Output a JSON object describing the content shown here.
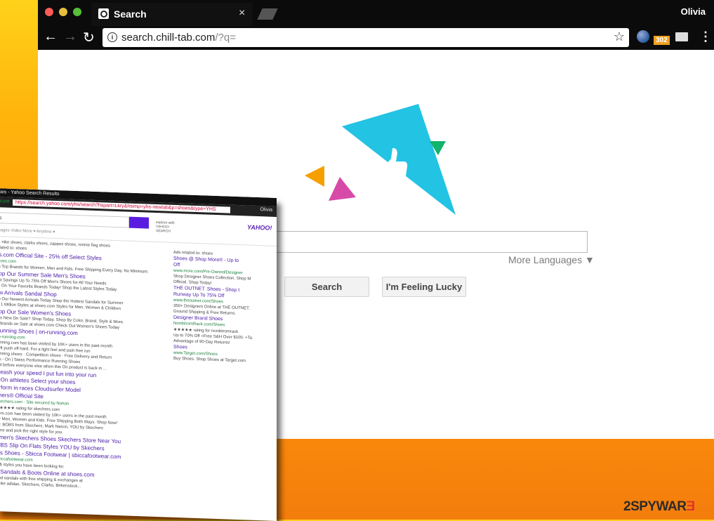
{
  "browser": {
    "tab_title": "Search",
    "tab_close": "×",
    "user": "Olivia",
    "url_host": "search.chill-tab.com",
    "url_rest": "/?q=",
    "ext_badge": "302",
    "back": "←",
    "forward": "→",
    "reload": "↻",
    "star": "☆",
    "menu": "⋮"
  },
  "page": {
    "more_languages": "More Languages ▼",
    "search_button": "Search",
    "lucky_button": "I'm Feeling Lucky",
    "logo_colors": {
      "main": "#22c3e3",
      "green": "#12b36d",
      "orange": "#f5a000",
      "pink": "#d84aa8"
    }
  },
  "overlay": {
    "title": "oes - Yahoo Search Results",
    "user": "Olivia",
    "secure": "ecure",
    "url": "https://search.yahoo.com/yhs/search?hspart=Lkry&hsimp=yhs-newtab&p=shoes&type=YHS",
    "query": "s",
    "yahoo_small": "explore with YAHOO! SEARCH",
    "yahoo_logo": "YAHOO!",
    "tabs": "Images      Video      More ▾      Anytime ▾",
    "results": [
      {
        "cls": "",
        "text": "ry: nike shoes, clarks shoes, zappos shoes, ronnie fieg shoes"
      },
      {
        "cls": "",
        "text": "related to: shoes"
      },
      {
        "cls": "h",
        "text": "es.com Official Site - 25% off Select Styles"
      },
      {
        "cls": "g",
        "text": "shoes.com"
      },
      {
        "cls": "",
        "text": "on Top Brands for Women, Men and Kids. Free Shipping Every Day, No Minimum."
      },
      {
        "cls": "h",
        "text": "hop Our Summer Sale        Men's Shoes"
      },
      {
        "cls": "",
        "text": "eat Savings Up To 75% Off    Men's Shoes for All Your Needs"
      },
      {
        "cls": "",
        "text": "ve On Your Favorite Brands Today!   Shop the Latest Styles Today"
      },
      {
        "cls": "h",
        "text": "ew Arrivals                Sandal Shop"
      },
      {
        "cls": "",
        "text": "op Our Newest Arrivals Today   Shop the Hottest Sandals for Summer"
      },
      {
        "cls": "",
        "text": "er 1 Million Styles at shoes.com   Styles for Men, Women & Children"
      },
      {
        "cls": "h",
        "text": "hop Our Sale               Women's Shoes"
      },
      {
        "cls": "",
        "text": "at's New On Sale? Shop Today.  Shop By Color, Brand, Style & More."
      },
      {
        "cls": "",
        "text": "p Brands on Sale at shoes.com   Check Out Women's Shoes Today"
      },
      {
        "cls": "h",
        "text": " Running Shoes | on-running.com"
      },
      {
        "cls": "g",
        "text": "on-running.com"
      },
      {
        "cls": "",
        "text": "running.com has been visited by 10K+ users in the past month"
      },
      {
        "cls": "",
        "text": "soft push off hard. For a light feel and pain free run"
      },
      {
        "cls": "",
        "text": "running shoes · Competition shoes · Free Delivery and Return"
      },
      {
        "cls": "",
        "text": "cts - On | Swiss Performance Running Shoes"
      },
      {
        "cls": "",
        "text": "out before everyone else when this On product is back in ..."
      },
      {
        "cls": "h",
        "text": "nleash your speed          I put fun into your run"
      },
      {
        "cls": "h",
        "text": "e On athletes              Select your shoes"
      },
      {
        "cls": "h",
        "text": "erform in races            Cloudsurfer Model"
      },
      {
        "cls": "h",
        "text": "chers® Official Site"
      },
      {
        "cls": "g",
        "text": "Skechers.com · Site secured by Norton"
      },
      {
        "cls": "",
        "text": "★★★★★ rating for skechers.com"
      },
      {
        "cls": "",
        "text": "hers.com has been visited by 10K+ users in the past month"
      },
      {
        "cls": "",
        "text": "for Men, Women and Kids. Free Shipping Both Ways. Shop Now!"
      },
      {
        "cls": "",
        "text": "ks: BOBS from Skechers, Mark Nason, YOU by Skechers"
      },
      {
        "cls": "",
        "text": "nline and pick the right style for you."
      },
      {
        "cls": "h",
        "text": "omen's Skechers Shoes       Skechers Store Near You"
      },
      {
        "cls": "h",
        "text": "OBS Slip On Flats Styles     YOU by Skechers"
      },
      {
        "cls": "h",
        "text": "n's Shoes - Sbicca Footwear | sbiccafootwear.com"
      },
      {
        "cls": "g",
        "text": "sbiccafootwear.com"
      },
      {
        "cls": "",
        "text": "n & styles you have been looking for."
      },
      {
        "cls": "h",
        "text": "s Sandals & Boots Online at shoes.com"
      },
      {
        "cls": "",
        "text": "and sandals with free shipping & exchanges at"
      },
      {
        "cls": "",
        "text": "...like adidas, Skechers, Clarks, Birkenstock..."
      }
    ],
    "ads": [
      {
        "cls": "",
        "text": "Ads related to: shoes"
      },
      {
        "cls": "h",
        "text": "Shoes @ Shop More® - Up to"
      },
      {
        "cls": "h",
        "text": "Off"
      },
      {
        "cls": "g",
        "text": "www.more.com/Pre-Owned/Designer"
      },
      {
        "cls": "",
        "text": "Shop Designer Shoes Collection. Shop M"
      },
      {
        "cls": "",
        "text": "Official. Shop Today!"
      },
      {
        "cls": "h",
        "text": "THE OUTNET: Shoes - Shop t"
      },
      {
        "cls": "h",
        "text": "Runway Up To 75% Off"
      },
      {
        "cls": "g",
        "text": "www.theoutnet.com/Shoes"
      },
      {
        "cls": "",
        "text": "350+ Designers Online at THE OUTNET."
      },
      {
        "cls": "",
        "text": "Ground Shipping & Free Returns."
      },
      {
        "cls": "h",
        "text": "Designer Brand Shoes"
      },
      {
        "cls": "g",
        "text": "NordstromRack.com/Shoes"
      },
      {
        "cls": "",
        "text": "★★★★★ rating for nordstromrack"
      },
      {
        "cls": "",
        "text": "Up to 70% Off +Free S&H Over $100. +Ta"
      },
      {
        "cls": "",
        "text": "Advantage of 90-Day Returns!"
      },
      {
        "cls": "h",
        "text": "Shoes"
      },
      {
        "cls": "g",
        "text": "www.Target.com/Shoes"
      },
      {
        "cls": "",
        "text": "Buy Shoes. Shop Shoes at Target.com"
      }
    ]
  },
  "watermark": {
    "part1": "2SPYWAR",
    "part2": "Ǝ"
  }
}
